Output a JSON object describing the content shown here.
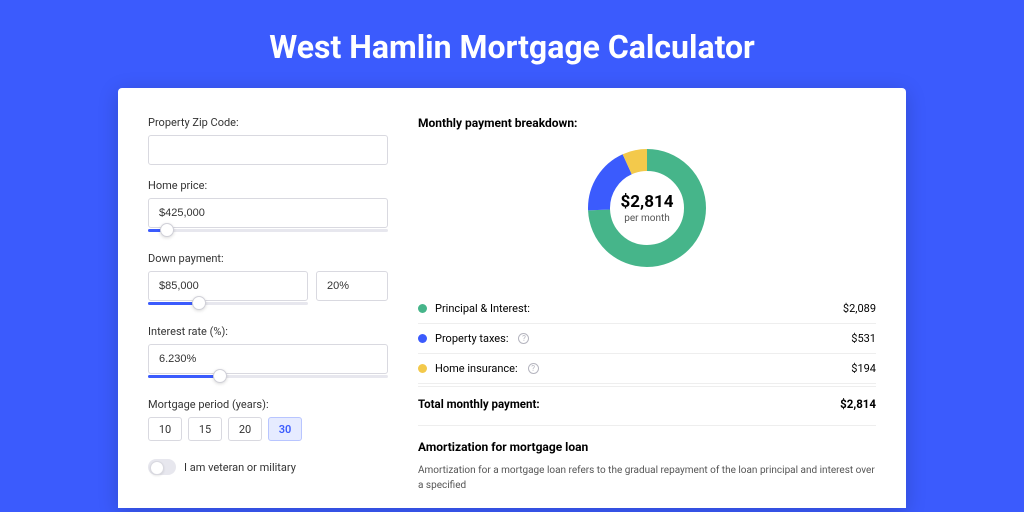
{
  "title": "West Hamlin Mortgage Calculator",
  "form": {
    "zip": {
      "label": "Property Zip Code:",
      "value": ""
    },
    "homePrice": {
      "label": "Home price:",
      "value": "$425,000",
      "sliderPercent": 8
    },
    "downPayment": {
      "label": "Down payment:",
      "amount": "$85,000",
      "percent": "20%",
      "sliderPercent": 20
    },
    "interest": {
      "label": "Interest rate (%):",
      "value": "6.230%",
      "sliderPercent": 30
    },
    "period": {
      "label": "Mortgage period (years):",
      "options": [
        "10",
        "15",
        "20",
        "30"
      ],
      "selected": "30"
    },
    "veteran": {
      "label": "I am veteran or military",
      "checked": false
    }
  },
  "breakdown": {
    "title": "Monthly payment breakdown:",
    "centerValue": "$2,814",
    "centerLabel": "per month",
    "items": [
      {
        "label": "Principal & Interest:",
        "value": "$2,089",
        "color": "#46b58a",
        "hasInfo": false
      },
      {
        "label": "Property taxes:",
        "value": "$531",
        "color": "#3b5bfd",
        "hasInfo": true
      },
      {
        "label": "Home insurance:",
        "value": "$194",
        "color": "#f3c94b",
        "hasInfo": true
      }
    ],
    "totalLabel": "Total monthly payment:",
    "totalValue": "$2,814"
  },
  "chart_data": {
    "type": "pie",
    "title": "Monthly payment breakdown",
    "series": [
      {
        "name": "Principal & Interest",
        "value": 2089,
        "color": "#46b58a"
      },
      {
        "name": "Property taxes",
        "value": 531,
        "color": "#3b5bfd"
      },
      {
        "name": "Home insurance",
        "value": 194,
        "color": "#f3c94b"
      }
    ],
    "total": 2814,
    "center_label": "$2,814 per month"
  },
  "amortization": {
    "title": "Amortization for mortgage loan",
    "text": "Amortization for a mortgage loan refers to the gradual repayment of the loan principal and interest over a specified"
  }
}
